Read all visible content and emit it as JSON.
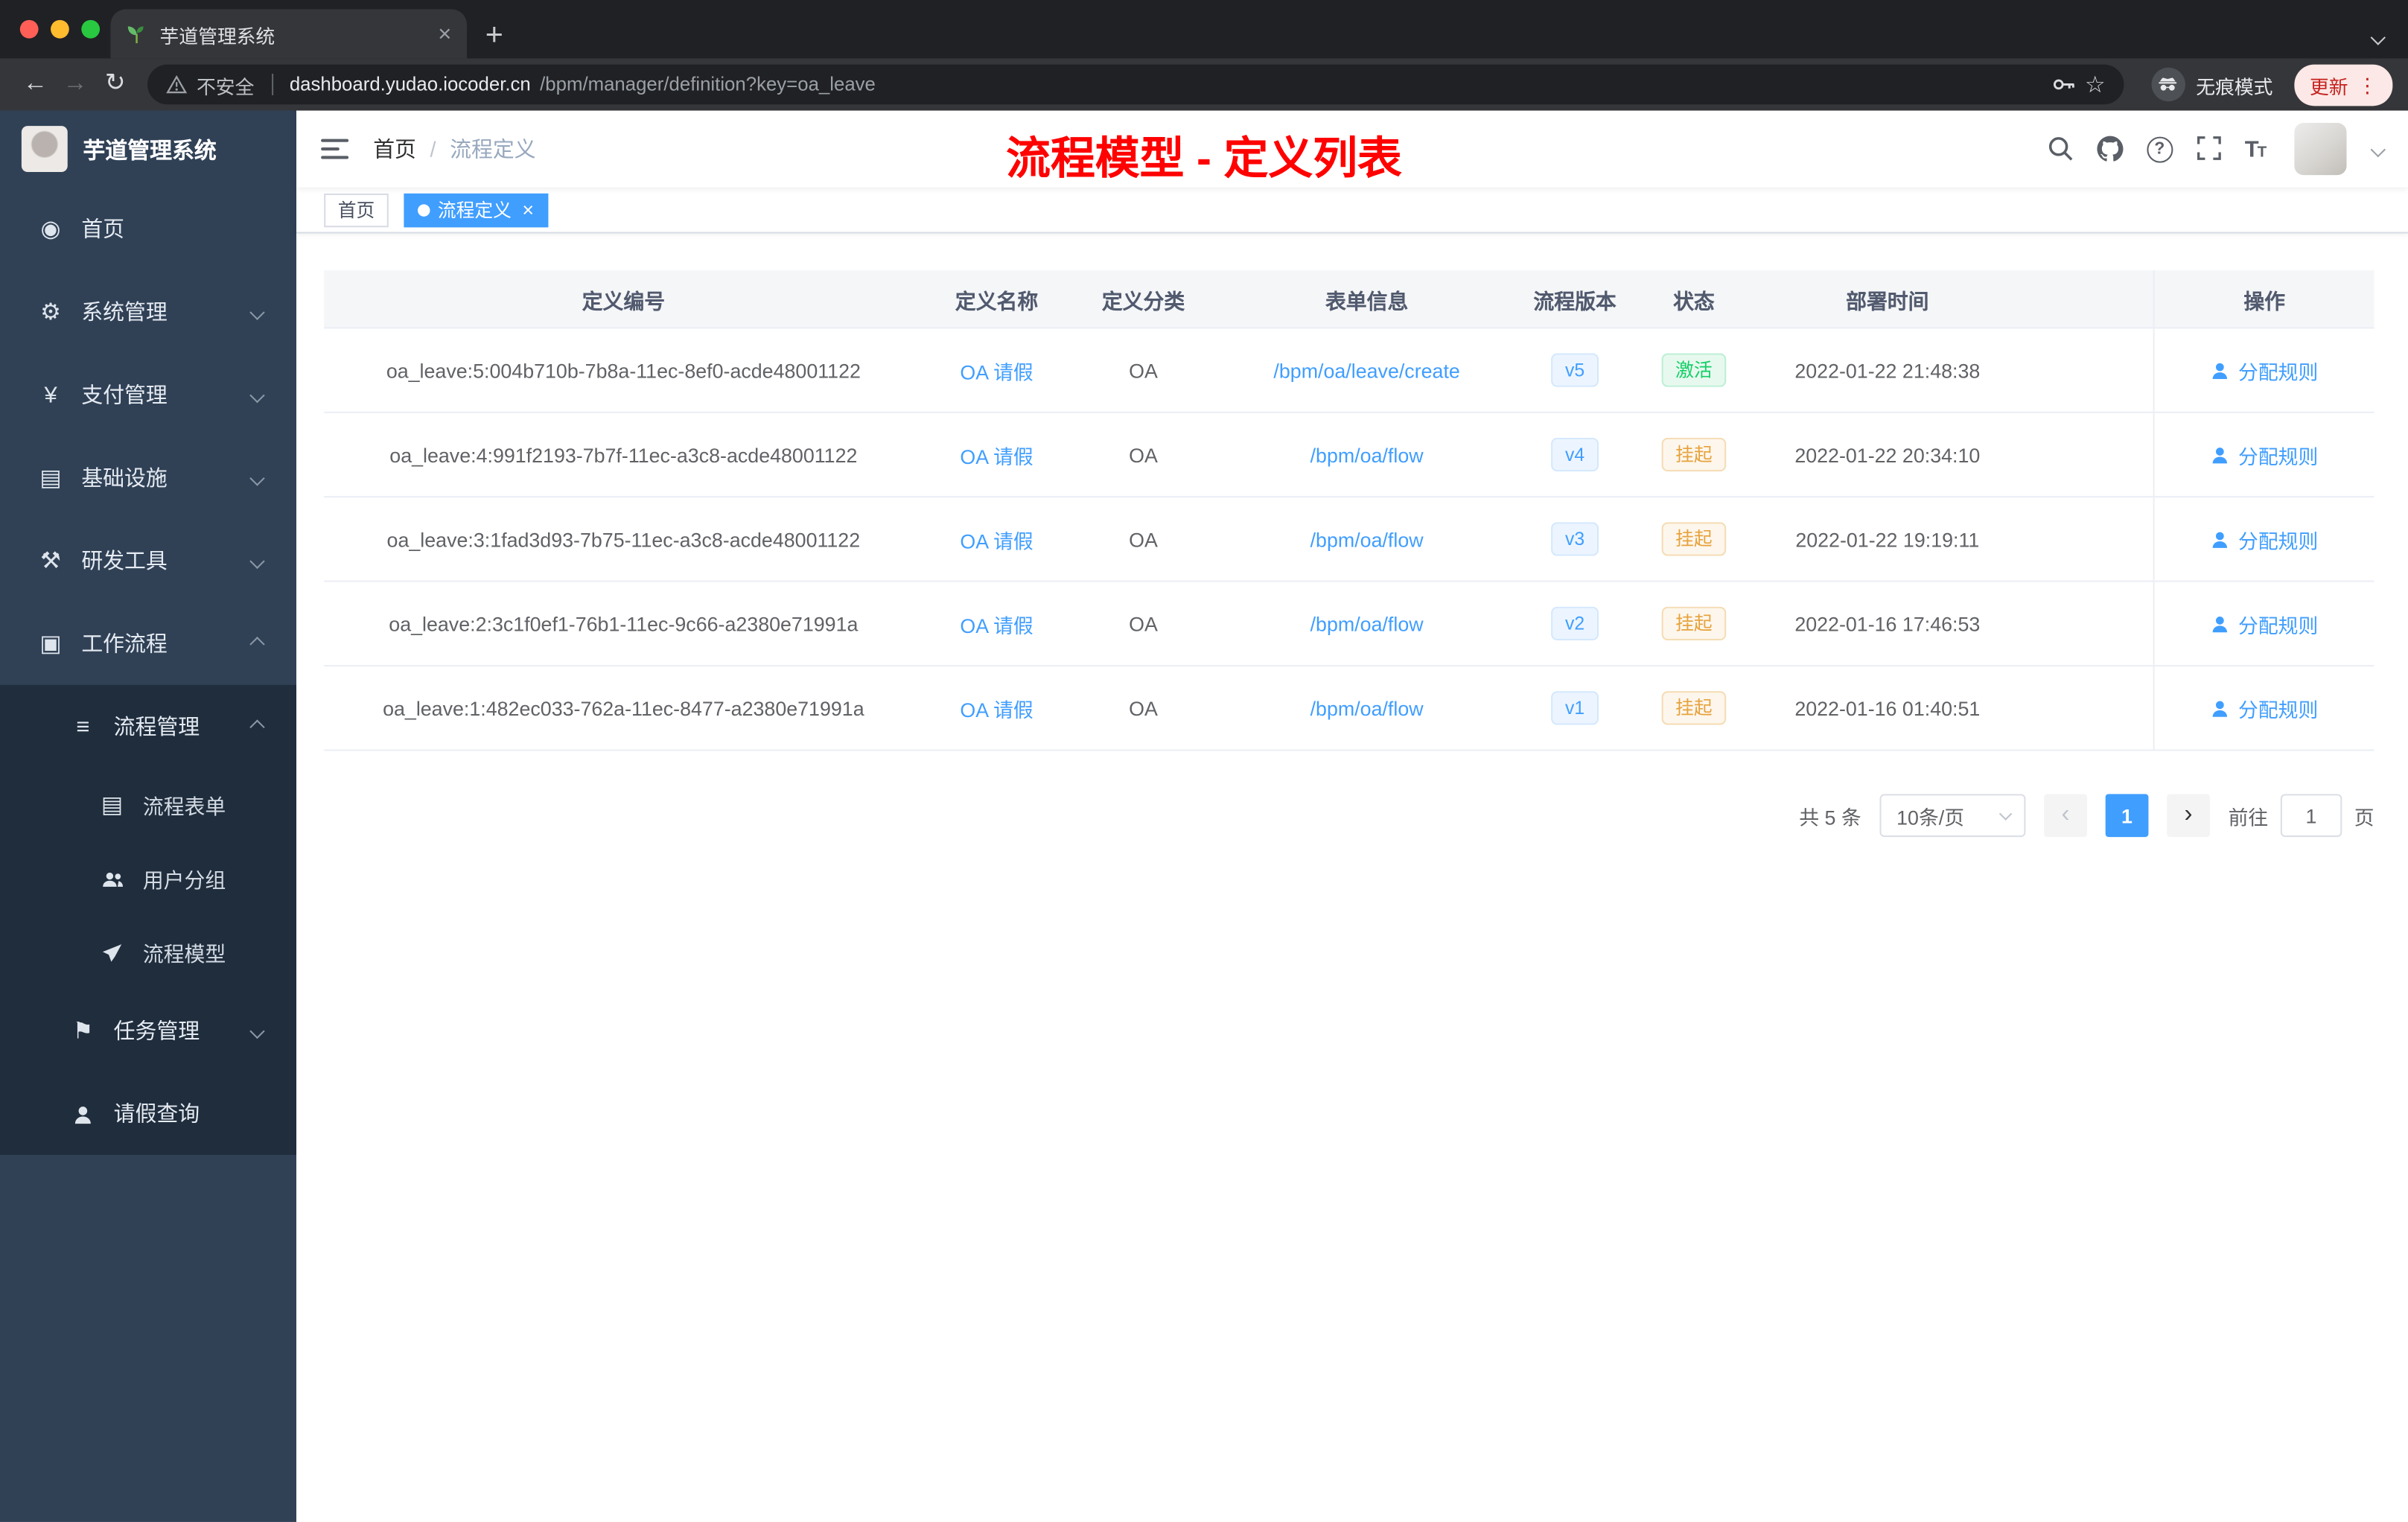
{
  "browser": {
    "tab_title": "芋道管理系统",
    "security_label": "不安全",
    "url_host": "dashboard.yudao.iocoder.cn",
    "url_path": "/bpm/manager/definition?key=oa_leave",
    "incognito_label": "无痕模式",
    "update_label": "更新"
  },
  "sidebar": {
    "logo_title": "芋道管理系统",
    "items": [
      {
        "label": "首页"
      },
      {
        "label": "系统管理"
      },
      {
        "label": "支付管理"
      },
      {
        "label": "基础设施"
      },
      {
        "label": "研发工具"
      },
      {
        "label": "工作流程"
      },
      {
        "label": "流程管理"
      },
      {
        "label": "流程表单"
      },
      {
        "label": "用户分组"
      },
      {
        "label": "流程模型"
      },
      {
        "label": "任务管理"
      },
      {
        "label": "请假查询"
      }
    ]
  },
  "header": {
    "breadcrumb_home": "首页",
    "breadcrumb_separator": "/",
    "breadcrumb_current": "流程定义",
    "annotation": "流程模型 - 定义列表"
  },
  "tags_view": {
    "tabs": [
      {
        "label": "首页",
        "active": false
      },
      {
        "label": "流程定义",
        "active": true
      }
    ]
  },
  "table": {
    "columns": [
      "定义编号",
      "定义名称",
      "定义分类",
      "表单信息",
      "流程版本",
      "状态",
      "部署时间",
      "操作"
    ],
    "action_label": "分配规则",
    "rows": [
      {
        "id": "oa_leave:5:004b710b-7b8a-11ec-8ef0-acde48001122",
        "name": "OA 请假",
        "category": "OA",
        "form": "/bpm/oa/leave/create",
        "version": "v5",
        "status": "激活",
        "status_type": "success",
        "deploy_time": "2022-01-22 21:48:38"
      },
      {
        "id": "oa_leave:4:991f2193-7b7f-11ec-a3c8-acde48001122",
        "name": "OA 请假",
        "category": "OA",
        "form": "/bpm/oa/flow",
        "version": "v4",
        "status": "挂起",
        "status_type": "warning",
        "deploy_time": "2022-01-22 20:34:10"
      },
      {
        "id": "oa_leave:3:1fad3d93-7b75-11ec-a3c8-acde48001122",
        "name": "OA 请假",
        "category": "OA",
        "form": "/bpm/oa/flow",
        "version": "v3",
        "status": "挂起",
        "status_type": "warning",
        "deploy_time": "2022-01-22 19:19:11"
      },
      {
        "id": "oa_leave:2:3c1f0ef1-76b1-11ec-9c66-a2380e71991a",
        "name": "OA 请假",
        "category": "OA",
        "form": "/bpm/oa/flow",
        "version": "v2",
        "status": "挂起",
        "status_type": "warning",
        "deploy_time": "2022-01-16 17:46:53"
      },
      {
        "id": "oa_leave:1:482ec033-762a-11ec-8477-a2380e71991a",
        "name": "OA 请假",
        "category": "OA",
        "form": "/bpm/oa/flow",
        "version": "v1",
        "status": "挂起",
        "status_type": "warning",
        "deploy_time": "2022-01-16 01:40:51"
      }
    ]
  },
  "pagination": {
    "total_label": "共 5 条",
    "page_size_label": "10条/页",
    "current_page": "1",
    "goto_prefix": "前往",
    "goto_value": "1",
    "goto_suffix": "页"
  },
  "colors": {
    "accent": "#409eff",
    "success": "#13ce66",
    "warning": "#e6a23c",
    "sidebar_bg": "#304156",
    "annotation_red": "#fe0100"
  }
}
